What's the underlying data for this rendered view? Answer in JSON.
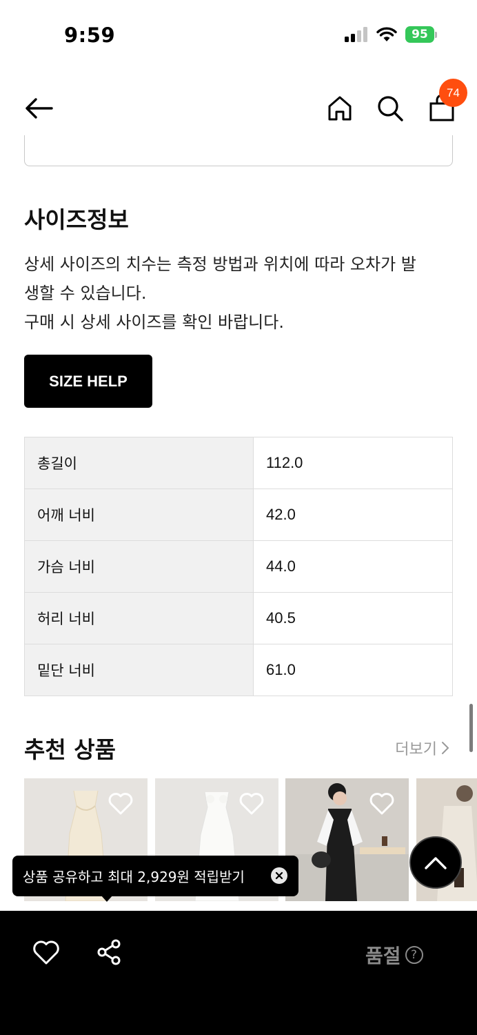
{
  "status_bar": {
    "time": "9:59",
    "battery": "95"
  },
  "nav": {
    "cart_count": "74"
  },
  "size_info": {
    "title": "사이즈정보",
    "description_lines": [
      "상세 사이즈의 치수는 측정 방법과 위치에 따라 오차가 발",
      "생할 수 있습니다.",
      "구매 시 상세 사이즈를 확인 바랍니다."
    ],
    "help_button": "SIZE HELP",
    "rows": [
      {
        "label": "총길이",
        "value": "112.0"
      },
      {
        "label": "어깨 너비",
        "value": "42.0"
      },
      {
        "label": "가슴 너비",
        "value": "44.0"
      },
      {
        "label": "허리 너비",
        "value": "40.5"
      },
      {
        "label": "밑단 너비",
        "value": "61.0"
      }
    ]
  },
  "recommended": {
    "title": "추천 상품",
    "more_label": "더보기"
  },
  "tooltip": {
    "text": "상품 공유하고 최대 2,929원 적립받기"
  },
  "bottom_bar": {
    "soldout_label": "품절",
    "help_glyph": "?"
  },
  "colors": {
    "badge": "#ff4e0f",
    "battery": "#34c759",
    "primary_button": "#000000"
  }
}
